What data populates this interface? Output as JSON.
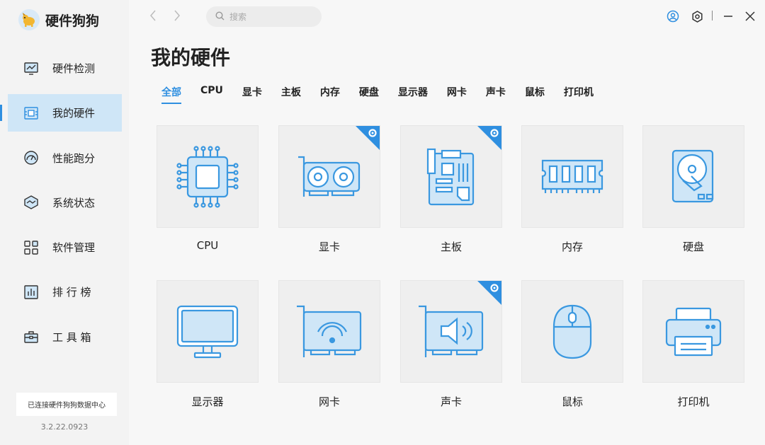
{
  "app": {
    "name": "硬件狗狗"
  },
  "sidebar": {
    "items": [
      {
        "label": "硬件检测",
        "icon": "monitor-chart-icon"
      },
      {
        "label": "我的硬件",
        "icon": "hardware-chip-icon",
        "active": true
      },
      {
        "label": "性能跑分",
        "icon": "speedometer-icon"
      },
      {
        "label": "系统状态",
        "icon": "system-status-icon"
      },
      {
        "label": "软件管理",
        "icon": "apps-grid-icon"
      },
      {
        "label": "排 行 榜",
        "icon": "ranking-chart-icon"
      },
      {
        "label": "工 具 箱",
        "icon": "toolbox-icon"
      }
    ],
    "status_text": "已连接硬件狗狗数据中心",
    "version": "3.2.22.0923"
  },
  "topbar": {
    "search_placeholder": "搜索"
  },
  "main": {
    "title": "我的硬件",
    "tabs": [
      "全部",
      "CPU",
      "显卡",
      "主板",
      "内存",
      "硬盘",
      "显示器",
      "网卡",
      "声卡",
      "鼠标",
      "打印机"
    ],
    "active_tab": "全部",
    "cards": [
      {
        "label": "CPU",
        "icon": "cpu-icon",
        "has_settings": false
      },
      {
        "label": "显卡",
        "icon": "graphics-card-icon",
        "has_settings": true
      },
      {
        "label": "主板",
        "icon": "motherboard-icon",
        "has_settings": true
      },
      {
        "label": "内存",
        "icon": "memory-icon",
        "has_settings": false
      },
      {
        "label": "硬盘",
        "icon": "hard-disk-icon",
        "has_settings": false
      },
      {
        "label": "显示器",
        "icon": "monitor-icon",
        "has_settings": false
      },
      {
        "label": "网卡",
        "icon": "network-card-icon",
        "has_settings": false
      },
      {
        "label": "声卡",
        "icon": "sound-card-icon",
        "has_settings": true
      },
      {
        "label": "鼠标",
        "icon": "mouse-icon",
        "has_settings": false
      },
      {
        "label": "打印机",
        "icon": "printer-icon",
        "has_settings": false
      }
    ]
  },
  "colors": {
    "accent": "#2f8fe0",
    "icon_fill": "#cfe6f7",
    "active_nav_bg": "#cfe6f7"
  }
}
